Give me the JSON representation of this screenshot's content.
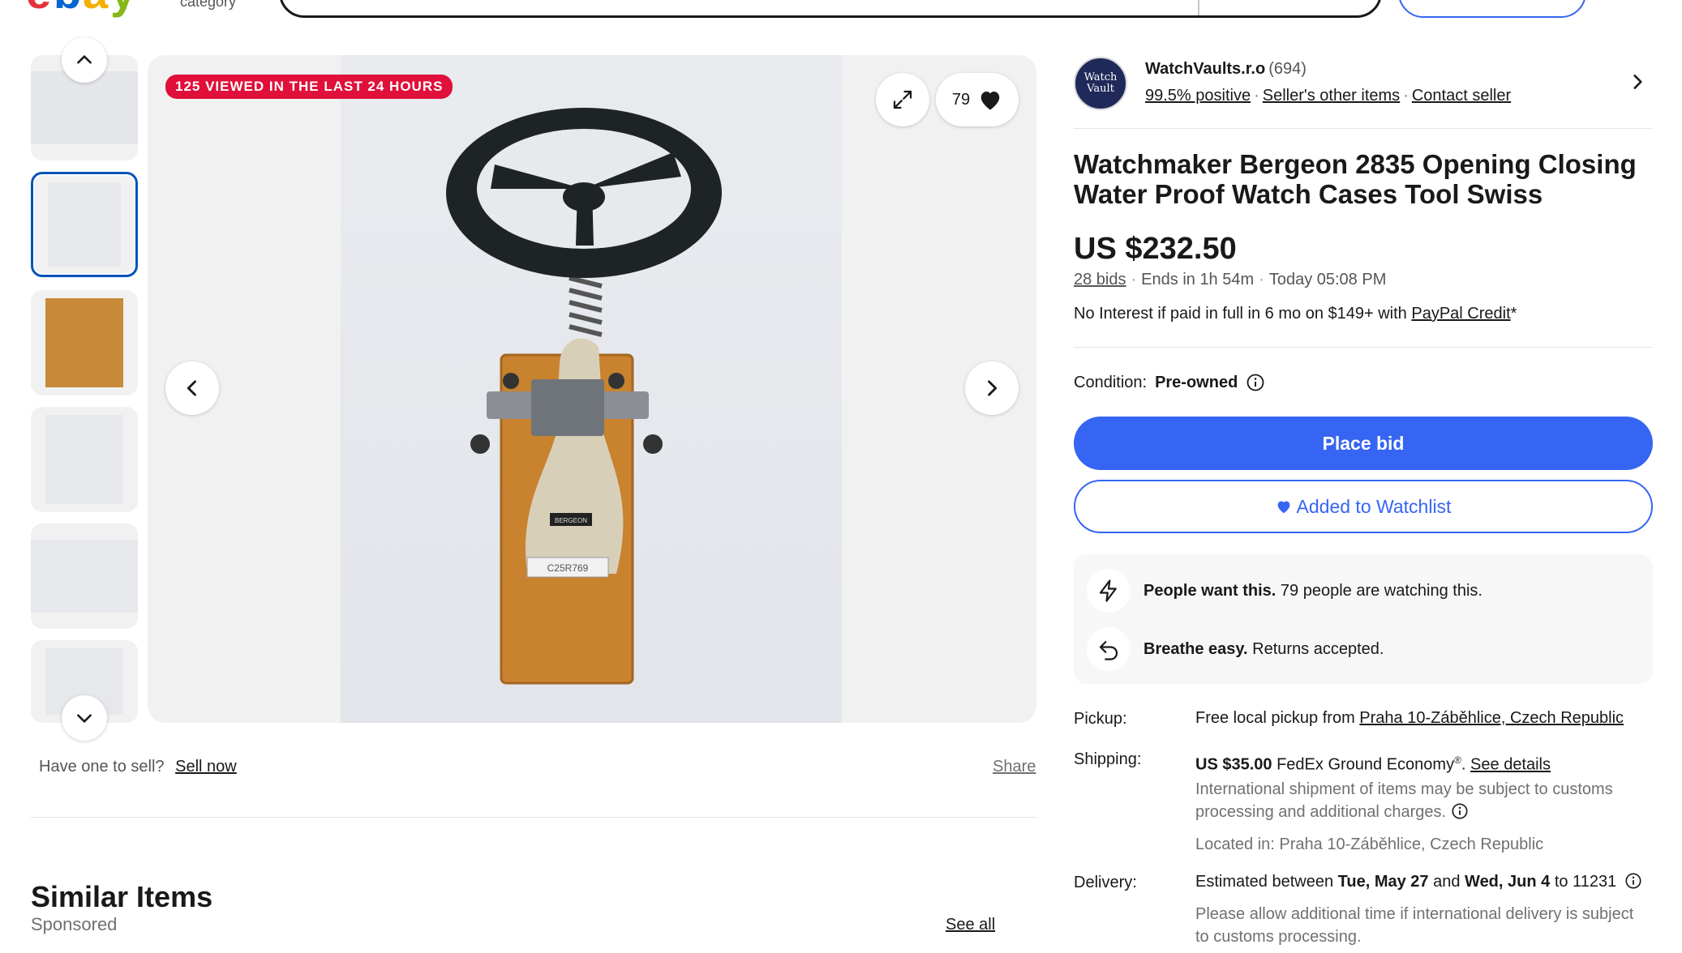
{
  "header": {
    "logo_text": "ebay",
    "shop_by_category": "category"
  },
  "gallery": {
    "viewed_badge": "125 VIEWED IN THE LAST 24 HOURS",
    "watch_count": "79",
    "label_on_item": "C25R769",
    "brand_on_item": "BERGEON"
  },
  "below_gallery": {
    "have_one": "Have one to sell?",
    "sell_now": "Sell now",
    "share": "Share"
  },
  "similar": {
    "title": "Similar Items",
    "sponsored": "Sponsored",
    "see_all": "See all"
  },
  "seller": {
    "avatar_text_1": "Watch",
    "avatar_text_2": "Vault",
    "name": "WatchVaults.r.o",
    "feedback_count": "(694)",
    "positive": "99.5% positive",
    "other_items": "Seller's other items",
    "contact": "Contact seller"
  },
  "item": {
    "title": "Watchmaker Bergeon 2835 Opening Closing Water Proof Watch Cases Tool Swiss",
    "price": "US $232.50",
    "bids": "28 bids",
    "ends_in": "Ends in 1h 54m",
    "end_time": "Today 05:08 PM",
    "credit_prefix": "No Interest if paid in full in 6 mo on $149+ with ",
    "credit_link": "PayPal Credit",
    "credit_suffix": "*",
    "condition_label": "Condition:",
    "condition_value": "Pre-owned"
  },
  "actions": {
    "place_bid": "Place bid",
    "watchlist": "Added to Watchlist"
  },
  "signals": {
    "want_bold": "People want this.",
    "want_text": "79 people are watching this.",
    "returns_bold": "Breathe easy.",
    "returns_text": "Returns accepted."
  },
  "shipping": {
    "pickup_label": "Pickup:",
    "pickup_prefix": "Free local pickup from ",
    "pickup_location": "Praha 10-Záběhlice, Czech Republic",
    "shipping_label": "Shipping:",
    "shipping_price": "US $35.00",
    "shipping_service": "FedEx Ground Economy",
    "shipping_reg": "®",
    "see_details": "See details",
    "intl_note": "International shipment of items may be subject to customs processing and additional charges.",
    "located_in": "Located in: Praha 10-Záběhlice, Czech Republic",
    "delivery_label": "Delivery:",
    "delivery_prefix": "Estimated between ",
    "delivery_start": "Tue, May 27",
    "delivery_and": " and ",
    "delivery_end": "Wed, Jun 4",
    "delivery_zip": " to 11231",
    "delivery_note": "Please allow additional time if international delivery is subject to customs processing."
  },
  "colors": {
    "primary_blue": "#3665f3",
    "badge_red": "#e0103a",
    "text": "#191919",
    "muted": "#707070"
  }
}
